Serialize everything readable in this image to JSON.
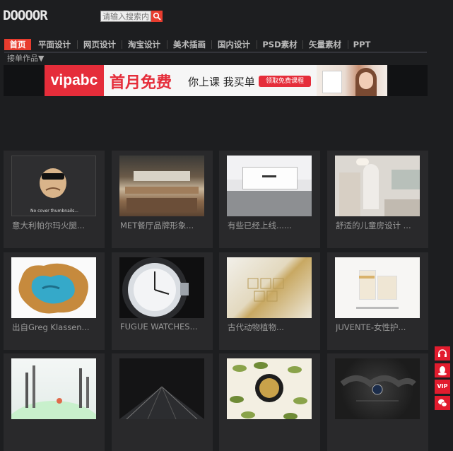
{
  "header": {
    "logo": "DOOOOR"
  },
  "search": {
    "placeholder": "请输入搜索内容"
  },
  "nav": {
    "items": [
      {
        "label": "首页",
        "active": true
      },
      {
        "label": "平面设计"
      },
      {
        "label": "网页设计"
      },
      {
        "label": "淘宝设计"
      },
      {
        "label": "美术插画"
      },
      {
        "label": "国内设计"
      },
      {
        "label": "PSD素材"
      },
      {
        "label": "矢量素材"
      },
      {
        "label": "PPT"
      }
    ],
    "sub": "接单作品▼"
  },
  "banner": {
    "logo": "vipabc",
    "headline": "首月免费",
    "subline": "你上课 我买单",
    "button": "领取免费课程"
  },
  "gallery": {
    "cards": [
      {
        "title": "意大利帕尔玛火腿...",
        "thumb_caption": "No cover thumbnails...",
        "thumb": "no-cover"
      },
      {
        "title": "MET餐厅品牌形象...",
        "thumb": "restaurant"
      },
      {
        "title": "有些已经上线......",
        "thumb": "office"
      },
      {
        "title": "舒适的儿童房设计 ...",
        "thumb": "kids-room"
      },
      {
        "title": "出自Greg Klassen...",
        "thumb": "river-table"
      },
      {
        "title": "FUGUE WATCHES...",
        "thumb": "watch"
      },
      {
        "title": "古代动物植物...",
        "thumb": "gold-pattern"
      },
      {
        "title": "JUVENTE-女性护...",
        "thumb": "cosmetics"
      },
      {
        "title": "",
        "thumb": "skyline"
      },
      {
        "title": "",
        "thumb": "tunnel"
      },
      {
        "title": "",
        "thumb": "olive"
      },
      {
        "title": "",
        "thumb": "watch-dark"
      }
    ]
  },
  "side_tools": {
    "vip_label": "VIP",
    "icons": [
      "headset-icon",
      "qq-icon",
      "vip-icon",
      "wechat-icon"
    ]
  },
  "colors": {
    "accent": "#e83c2e",
    "background": "#1d1e20",
    "card": "#29292b"
  }
}
